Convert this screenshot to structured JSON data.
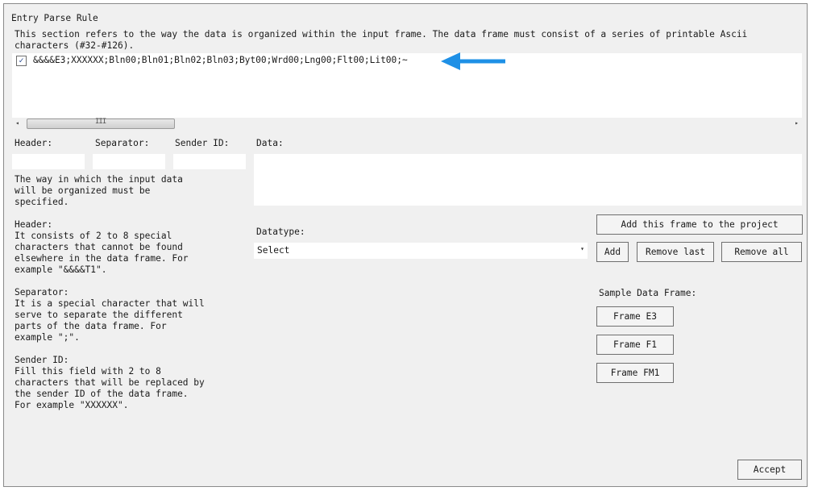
{
  "group": {
    "title": "Entry Parse Rule",
    "description": "This section refers to the way the data is organized within the input frame. The data frame must consist of a series of printable Ascii characters (#32-#126)."
  },
  "rule_list": {
    "items": [
      {
        "checked": true,
        "check_glyph": "✓",
        "text": "&&&&E3;XXXXXX;Bln00;Bln01;Bln02;Bln03;Byt00;Wrd00;Lng00;Flt00;Lit00;~"
      }
    ],
    "scroll": {
      "left_glyph": "◂",
      "right_glyph": "▸",
      "grip_glyph": "III"
    }
  },
  "fields": {
    "header_label": "Header:",
    "separator_label": "Separator:",
    "sender_label": "Sender ID:",
    "data_label": "Data:",
    "header_value": "",
    "separator_value": "",
    "sender_value": "",
    "data_value": ""
  },
  "help": {
    "intro": "The way in which the input data\nwill be organized must be\nspecified.",
    "header_title": "Header:",
    "header_body": "It consists of 2 to 8 special\ncharacters that cannot be found\nelsewhere in the data frame. For\nexample \"&&&&T1\".",
    "separator_title": "Separator:",
    "separator_body": "It is a special character that will\nserve to separate the different\nparts of the data frame. For\nexample \";\".",
    "sender_title": "Sender ID:",
    "sender_body": "Fill this field with 2 to 8\ncharacters that will be replaced by\nthe sender ID of the data frame.\nFor example \"XXXXXX\"."
  },
  "datatype": {
    "label": "Datatype:",
    "selected": "Select",
    "arrow_glyph": "▾"
  },
  "buttons": {
    "add_frame": "Add this frame to the project",
    "add": "Add",
    "remove_last": "Remove last",
    "remove_all": "Remove all",
    "accept": "Accept"
  },
  "sample": {
    "label": "Sample Data Frame:",
    "frames": [
      "Frame E3",
      "Frame F1",
      "Frame FM1"
    ]
  },
  "colors": {
    "panel_bg": "#f0f0f0",
    "annotation_arrow": "#1e90e6"
  },
  "annotation": {
    "icon": "arrow-left-icon"
  }
}
